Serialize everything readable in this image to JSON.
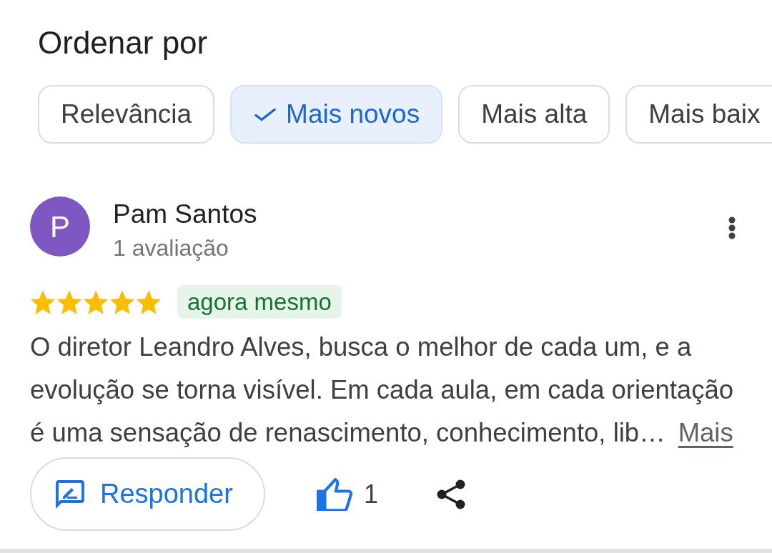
{
  "sort": {
    "title": "Ordenar por",
    "chips": [
      {
        "label": "Relevância",
        "selected": false
      },
      {
        "label": "Mais novos",
        "selected": true
      },
      {
        "label": "Mais alta",
        "selected": false
      },
      {
        "label": "Mais baix",
        "selected": false
      }
    ]
  },
  "review": {
    "avatar_letter": "P",
    "name": "Pam Santos",
    "subtitle": "1 avaliação",
    "stars": 5,
    "time": "agora mesmo",
    "text": "O diretor Leandro Alves, busca o melhor de cada um, e a evolução se torna visível. Em cada aula, em cada orientação é uma sensação de renascimento, conhecimento, lib…",
    "more_link": "Mais",
    "reply_button": "Responder",
    "likes": {
      "count": "1",
      "liked": true
    }
  }
}
